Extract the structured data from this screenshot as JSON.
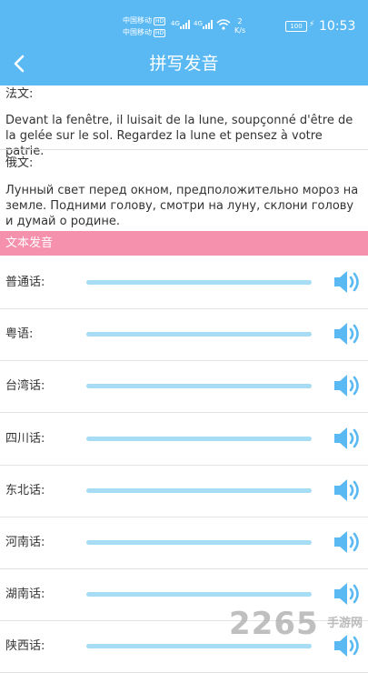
{
  "status_bar": {
    "carrier1": "中国移动",
    "carrier2": "中国移动",
    "hd": "HD",
    "network1": "4G",
    "network2": "4G",
    "speed_value": "2",
    "speed_unit": "K/s",
    "battery": "100",
    "time": "10:53"
  },
  "header": {
    "title": "拼写发音",
    "back_icon": "chevron-left-icon"
  },
  "translations": [
    {
      "label": "法文:",
      "text": "Devant la fenêtre, il luisait de la lune, soupçonné d'être de la gelée sur le sol. Regardez la lune et pensez à votre patrie."
    },
    {
      "label": "俄文:",
      "text": "Лунный свет перед окном, предположительно мороз на земле. Подними голову, смотри на луну, склони голову и думай о родине."
    }
  ],
  "section": {
    "title": "文本发音"
  },
  "dialects": [
    {
      "label": "普通话:",
      "progress": 0
    },
    {
      "label": "粤语:",
      "progress": 0
    },
    {
      "label": "台湾话:",
      "progress": 0
    },
    {
      "label": "四川话:",
      "progress": 0
    },
    {
      "label": "东北话:",
      "progress": 0
    },
    {
      "label": "河南话:",
      "progress": 0
    },
    {
      "label": "湖南话:",
      "progress": 0
    },
    {
      "label": "陕西话:",
      "progress": 0
    }
  ],
  "speaker_icon": "speaker-volume-icon",
  "watermark": {
    "number": "2265",
    "suffix": "手游网",
    "suffix_domain": ".com"
  },
  "colors": {
    "primary": "#5ab9f3",
    "track": "#a7dcf5",
    "section_bar": "#f590ad"
  }
}
